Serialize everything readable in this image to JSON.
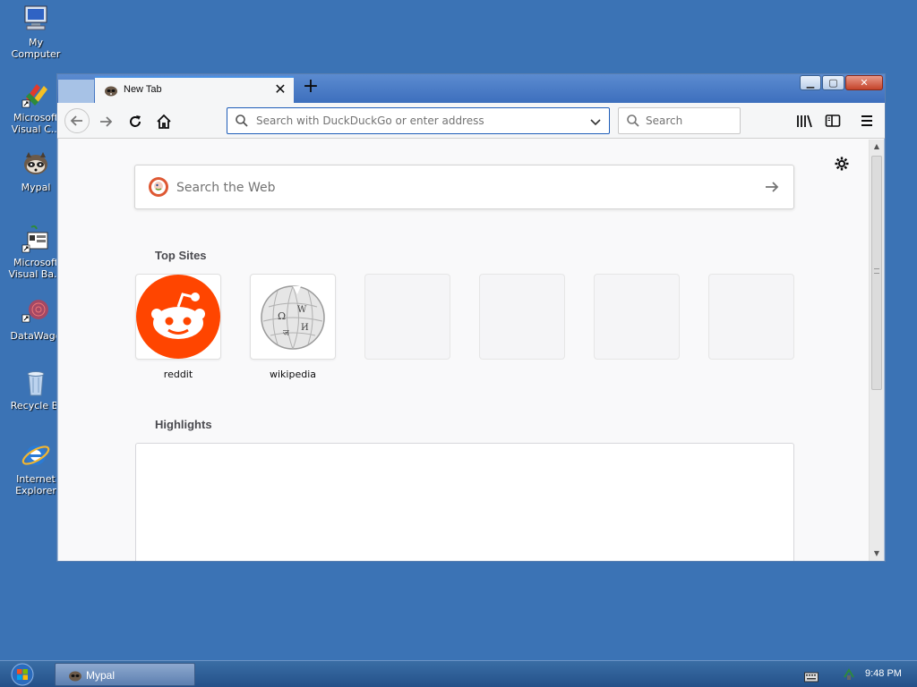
{
  "desktop": {
    "icons": [
      {
        "label": "My Computer"
      },
      {
        "label": "Microsoft Visual C..."
      },
      {
        "label": "Mypal"
      },
      {
        "label": "Microsoft Visual Ba..."
      },
      {
        "label": "DataWago"
      },
      {
        "label": "Recycle Bi"
      },
      {
        "label": "Internet Explorer"
      }
    ]
  },
  "browser": {
    "tab": {
      "title": "New Tab"
    },
    "urlbar": {
      "placeholder": "Search with DuckDuckGo or enter address"
    },
    "searchbar": {
      "placeholder": "Search"
    },
    "colors": {
      "accent": "#1e5db8",
      "tab_highlight": "#4a90e2"
    }
  },
  "newtab": {
    "web_search": {
      "placeholder": "Search the Web"
    },
    "top_sites": {
      "title": "Top Sites",
      "sites": [
        {
          "label": "reddit",
          "icon": "reddit-icon",
          "color": "#ff4500"
        },
        {
          "label": "wikipedia",
          "icon": "wikipedia-icon"
        }
      ],
      "empty_slots": 4
    },
    "highlights": {
      "title": "Highlights"
    }
  },
  "taskbar": {
    "task": {
      "label": "Mypal"
    },
    "clock": "9:48 PM"
  }
}
